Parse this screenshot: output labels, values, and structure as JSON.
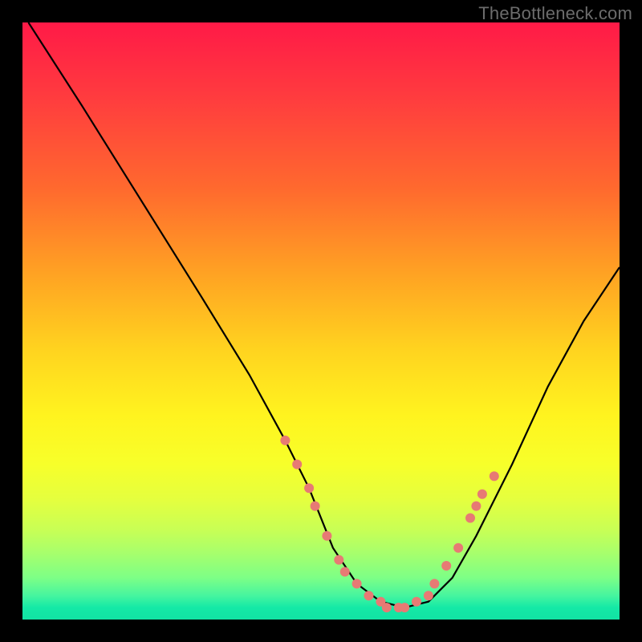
{
  "watermark": "TheBottleneck.com",
  "colors": {
    "page_bg": "#000000",
    "curve": "#000000",
    "points": "#e77a74",
    "band_yellow": "#faff55",
    "band_green": "#14e9a6",
    "gradient_top": "#ff1a47",
    "gradient_bottom": "#12e3a3"
  },
  "chart_data": {
    "type": "line",
    "title": "",
    "xlabel": "",
    "ylabel": "",
    "xlim": [
      0,
      100
    ],
    "ylim": [
      0,
      100
    ],
    "grid": false,
    "legend": false,
    "series": [
      {
        "name": "bottleneck-curve",
        "x": [
          1,
          10,
          20,
          30,
          38,
          44,
          48,
          52,
          56,
          60,
          64,
          68,
          72,
          76,
          82,
          88,
          94,
          100
        ],
        "y": [
          100,
          86,
          70,
          54,
          41,
          30,
          22,
          12,
          6,
          3,
          2,
          3,
          7,
          14,
          26,
          39,
          50,
          59
        ]
      }
    ],
    "highlight_points": {
      "name": "highlight-dots",
      "x": [
        44,
        46,
        48,
        49,
        51,
        53,
        54,
        56,
        58,
        60,
        61,
        63,
        64,
        66,
        68,
        69,
        71,
        73,
        75,
        76,
        77,
        79
      ],
      "y": [
        30,
        26,
        22,
        19,
        14,
        10,
        8,
        6,
        4,
        3,
        2,
        2,
        2,
        3,
        4,
        6,
        9,
        12,
        17,
        19,
        21,
        24
      ]
    },
    "bands": [
      {
        "name": "yellow-band",
        "y_from": 18,
        "y_to": 26,
        "color": "#faff55"
      },
      {
        "name": "green-band",
        "y_from": 0,
        "y_to": 2,
        "color": "#14e9a6"
      }
    ]
  }
}
